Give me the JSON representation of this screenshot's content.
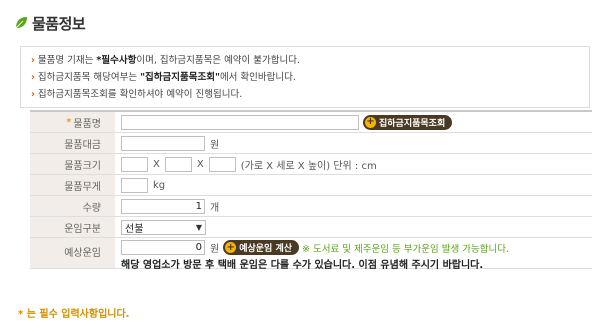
{
  "section": {
    "title": "물품정보"
  },
  "notice": {
    "lines": [
      {
        "prefix": "물품명 기재는 ",
        "emphasis": "*필수사항",
        "suffix": "이며, 집하금지품목은 예약이 불가합니다."
      },
      {
        "prefix": "집하금지품목 해당여부는 ",
        "emphasis": "\"집하금지품목조회\"",
        "suffix": "에서 확인바랍니다."
      },
      {
        "prefix": "집하금지품목조회를 확인하셔야 예약이 진행됩니다.",
        "emphasis": "",
        "suffix": ""
      }
    ]
  },
  "form": {
    "item_name": {
      "required_mark": "*",
      "label": "물품명",
      "value": "",
      "button": "집하금지품목조회"
    },
    "item_price": {
      "label": "물품대금",
      "value": "",
      "unit": "원"
    },
    "item_size": {
      "label": "물품크기",
      "w": "",
      "d": "",
      "h": "",
      "sep": "X",
      "unit": "(가로 X 세로 X 높이) 단위 : cm"
    },
    "item_weight": {
      "label": "물품무게",
      "value": "",
      "unit": "kg"
    },
    "quantity": {
      "label": "수량",
      "value": "1",
      "unit": "개"
    },
    "freight_type": {
      "label": "운임구분",
      "selected": "선불"
    },
    "estimated_fare": {
      "label": "예상운임",
      "value": "0",
      "unit": "원",
      "button": "예상운임 계산",
      "note": "※ 도서료 및 제주운임 등 부가운임 발생 가능합니다.",
      "note2": "해당 영업소가 방문 후 택배 운임은 다를 수가 있습니다. 이점 유념해 주시기 바랍니다."
    }
  },
  "footer": {
    "text": "* 는 필수 입력사항입니다."
  },
  "colors": {
    "accent": "#4a3a24",
    "label_bg": "#f2ede8",
    "required": "#e07b00",
    "note": "#5aa51a",
    "leaf": "#5aa51a"
  }
}
